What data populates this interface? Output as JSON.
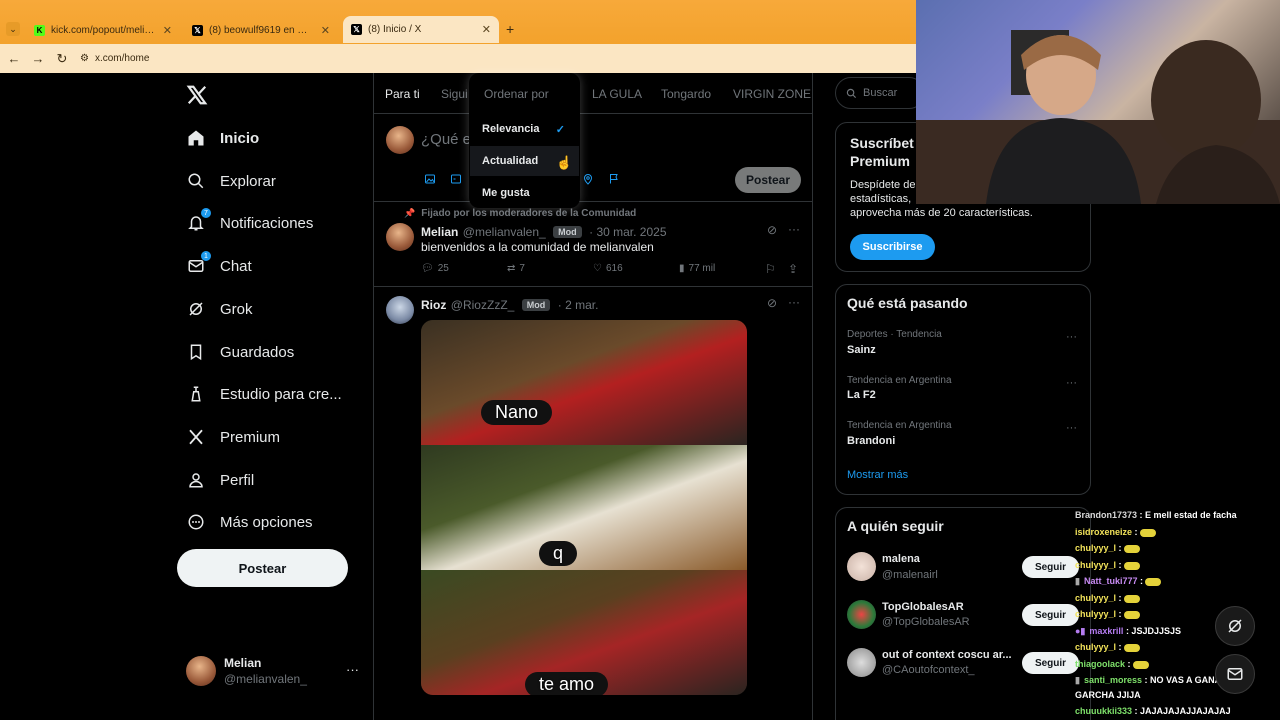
{
  "browser": {
    "tabs": [
      {
        "title": "kick.com/popout/melianvalen/c",
        "active": false
      },
      {
        "title": "(8) beowulf9619 en X: \"despué",
        "active": false
      },
      {
        "title": "(8) Inicio / X",
        "active": true
      }
    ],
    "new_tab": "+",
    "url": "x.com/home"
  },
  "sidebar": {
    "logo": "X",
    "items": [
      {
        "label": "Inicio",
        "icon": "home-icon"
      },
      {
        "label": "Explorar",
        "icon": "search-icon"
      },
      {
        "label": "Notificaciones",
        "icon": "bell-icon",
        "badge": "7"
      },
      {
        "label": "Chat",
        "icon": "mail-icon",
        "badge": "1"
      },
      {
        "label": "Grok",
        "icon": "grok-icon"
      },
      {
        "label": "Guardados",
        "icon": "bookmark-icon"
      },
      {
        "label": "Estudio para cre...",
        "icon": "creator-studio-icon"
      },
      {
        "label": "Premium",
        "icon": "x-premium-icon"
      },
      {
        "label": "Perfil",
        "icon": "person-icon"
      },
      {
        "label": "Más opciones",
        "icon": "more-circle-icon"
      }
    ],
    "post_button": "Postear",
    "account": {
      "name": "Melian",
      "handle": "@melianvalen_",
      "more": "···"
    }
  },
  "main": {
    "tabs": [
      "Para ti",
      "Sigui",
      "LA GULA",
      "Tongardo",
      "VIRGIN ZONE"
    ],
    "composer": {
      "placeholder": "¿Qué es",
      "post_label": "Postear"
    },
    "sort_menu": {
      "header": "Ordenar por",
      "options": [
        {
          "label": "Relevancia",
          "selected": true
        },
        {
          "label": "Actualidad",
          "selected": false
        },
        {
          "label": "Me gusta",
          "selected": false
        }
      ]
    },
    "pinned_label": "Fijado por los moderadores de la Comunidad",
    "tweets": [
      {
        "name": "Melian",
        "handle": "@melianvalen_",
        "badge": "Mod",
        "date": "· 30 mar. 2025",
        "text": "bienvenidos a la comunidad de melianvalen",
        "replies": "25",
        "reposts": "7",
        "likes": "616",
        "views": "77 mil"
      },
      {
        "name": "Rioz",
        "handle": "@RiozZzZ_",
        "badge": "Mod",
        "date": "· 2 mar.",
        "captions": [
          "Nano",
          "q",
          "te amo"
        ]
      }
    ]
  },
  "right": {
    "search_placeholder": "Buscar",
    "premium": {
      "title_line1": "Suscríbet",
      "title_line2": "Premium",
      "desc_line1": "Despídete de",
      "desc_line2": "estadísticas,",
      "desc_line3": "aprovecha más de 20 características.",
      "button": "Suscribirse"
    },
    "trends": {
      "title": "Qué está pasando",
      "items": [
        {
          "meta": "Deportes · Tendencia",
          "name": "Sainz"
        },
        {
          "meta": "Tendencia en Argentina",
          "name": "La F2"
        },
        {
          "meta": "Tendencia en Argentina",
          "name": "Brandoni"
        }
      ],
      "show_more": "Mostrar más",
      "more": "···"
    },
    "who_to_follow": {
      "title": "A quién seguir",
      "items": [
        {
          "name": "malena",
          "handle": "@malenairl",
          "button": "Seguir"
        },
        {
          "name": "TopGlobalesAR",
          "handle": "@TopGlobalesAR",
          "button": "Seguir"
        },
        {
          "name": "out of context coscu ar...",
          "handle": "@CAoutofcontext_",
          "button": "Seguir"
        }
      ]
    }
  },
  "chat": {
    "lines": [
      {
        "user": "Brandon17373",
        "msg": ": E mell estad de facha",
        "color": "#d8d8d8"
      },
      {
        "user": "isidroxeneize",
        "msg": ":",
        "color": "#f2e35a",
        "emote": true
      },
      {
        "user": "chulyyy_l",
        "msg": ":",
        "color": "#f2e35a",
        "emote": true
      },
      {
        "user": "chulyyy_l",
        "msg": ":",
        "color": "#f2e35a",
        "emote": true
      },
      {
        "user": "Natt_tuki777",
        "msg": ":",
        "color": "#c98cf5",
        "emote": true
      },
      {
        "user": "chulyyy_l",
        "msg": ":",
        "color": "#f2e35a",
        "emote": true
      },
      {
        "user": "chulyyy_l",
        "msg": ":",
        "color": "#f2e35a",
        "emote": true
      },
      {
        "user": "maxkrill",
        "msg": ": JSJDJJSJS",
        "color": "#b47cf0"
      },
      {
        "user": "chulyyy_l",
        "msg": ":",
        "color": "#f2e35a",
        "emote": true
      },
      {
        "user": "thiagoolack",
        "msg": ":",
        "color": "#7ee06a",
        "emote": true
      },
      {
        "user": "santi_moress",
        "msg": ": NO VAS A GANAR UNA",
        "color": "#7ee06a"
      },
      {
        "user": "",
        "msg": "GARCHA JJIJA",
        "color": "#fff"
      },
      {
        "user": "chuuukkii333",
        "msg": ": JAJAJAJAJJAJAJAJ",
        "color": "#7ee06a"
      }
    ]
  },
  "colors": {
    "accent": "#1d9bf0",
    "browser_tab": "#f6a623",
    "bg": "#000000"
  }
}
